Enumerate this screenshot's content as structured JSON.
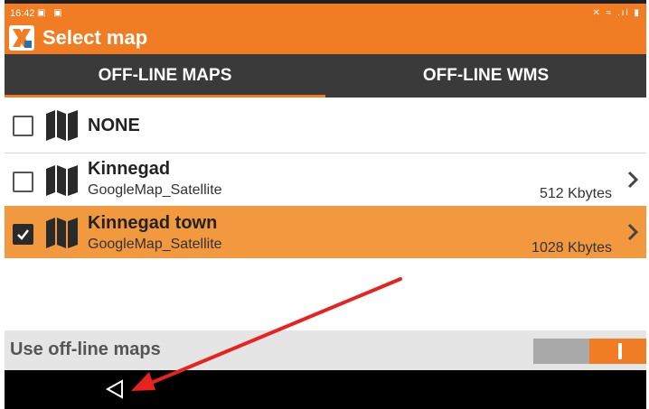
{
  "status_bar": {
    "time": "16:42",
    "left_icons": "▣ ▣",
    "right_icons": "✕ ≈ .ıl ▮"
  },
  "app": {
    "title": "Select map",
    "logo_icon": "app-logo-icon"
  },
  "tabs": [
    {
      "label": "OFF-LINE MAPS",
      "selected": true
    },
    {
      "label": "OFF-LINE WMS",
      "selected": false
    }
  ],
  "maps": [
    {
      "name": "NONE",
      "checked": false,
      "selected": false
    },
    {
      "name": "Kinnegad",
      "source": "GoogleMap_Satellite",
      "size": "512 Kbytes",
      "checked": false,
      "selected": false
    },
    {
      "name": "Kinnegad town",
      "source": "GoogleMap_Satellite",
      "size": "1028 Kbytes",
      "checked": true,
      "selected": true
    }
  ],
  "offline": {
    "label": "Use off-line maps",
    "enabled": true
  },
  "colors": {
    "accent": "#f07d23",
    "tabs_bg": "#3a3a3a",
    "selected_row": "#f2983f",
    "annotation": "#e8231f"
  }
}
